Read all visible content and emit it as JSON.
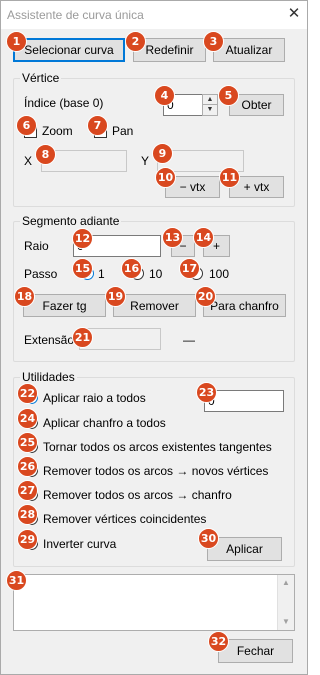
{
  "window": {
    "title": "Assistente de curva única",
    "close_glyph": "✕"
  },
  "toolbar": {
    "select_curve": "Selecionar curva",
    "reset": "Redefinir",
    "update": "Atualizar"
  },
  "vertex": {
    "group_title": "Vértice",
    "index_label": "Índice (base 0)",
    "index_value": "0",
    "get_button": "Obter",
    "zoom_label": "Zoom",
    "pan_label": "Pan",
    "x_label": "X",
    "y_label": "Y",
    "x_value": "",
    "y_value": "",
    "minus_vtx": "− vtx",
    "plus_vtx": "+ vtx"
  },
  "segment": {
    "group_title": "Segmento adiante",
    "radius_label": "Raio",
    "radius_value": "0",
    "minus": "−",
    "plus": "+",
    "step_label": "Passo",
    "steps": [
      "1",
      "10",
      "100"
    ],
    "tangent_button": "Fazer tg",
    "remove_button": "Remover",
    "chamfer_button": "Para chanfro",
    "extension_label": "Extensão",
    "extension_value": "",
    "extension_dash": "—"
  },
  "utilities": {
    "group_title": "Utilidades",
    "options": [
      "Aplicar raio a todos",
      "Aplicar chanfro a todos",
      "Tornar todos os arcos existentes tangentes",
      "Remover todos os arcos → novos vértices",
      "Remover todos os arcos → chanfro",
      "Remover vértices coincidentes",
      "Inverter curva"
    ],
    "radius_all_value": "0",
    "apply_button": "Aplicar"
  },
  "output": {
    "text": ""
  },
  "footer": {
    "close_button": "Fechar"
  },
  "badges": [
    "1",
    "2",
    "3",
    "4",
    "5",
    "6",
    "7",
    "8",
    "9",
    "10",
    "11",
    "12",
    "13",
    "14",
    "15",
    "16",
    "17",
    "18",
    "19",
    "20",
    "21",
    "22",
    "23",
    "24",
    "25",
    "26",
    "27",
    "28",
    "29",
    "30",
    "31",
    "32"
  ],
  "colors": {
    "badge": "#d9481f",
    "accent": "#0078d7",
    "window_bg": "#f0f0f0"
  }
}
